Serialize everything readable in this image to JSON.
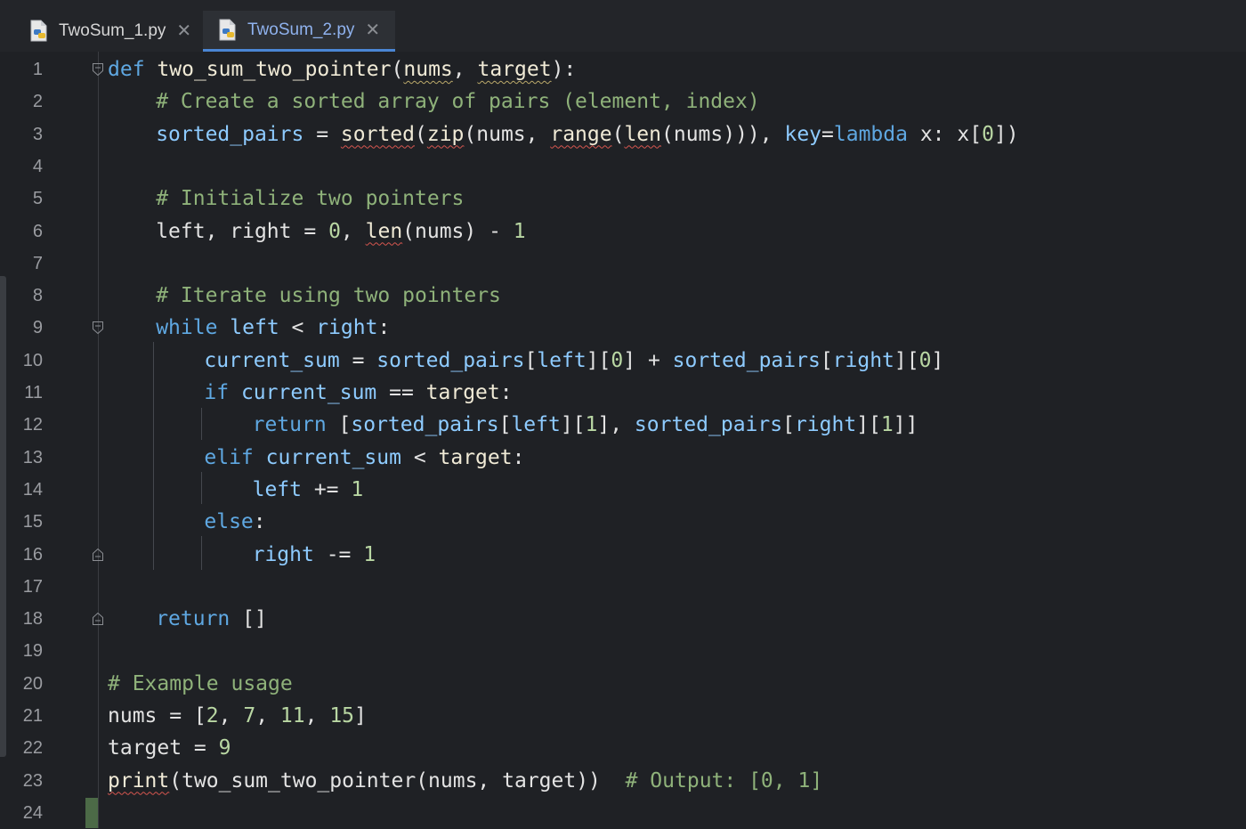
{
  "tabs": [
    {
      "label": "TwoSum_1.py",
      "active": false
    },
    {
      "label": "TwoSum_2.py",
      "active": true
    }
  ],
  "icons": {
    "file": "python-file-icon",
    "close": "close-icon",
    "fold": "fold-marker-icon"
  },
  "colors": {
    "keyword": "#5fa8e2",
    "comment": "#8fb27a",
    "number": "#b9d7a3",
    "variable": "#8ecbff",
    "active_tab": "#8fb2ee",
    "error_squiggle": "#d6564f"
  },
  "line_numbers": [
    "1",
    "2",
    "3",
    "4",
    "5",
    "6",
    "7",
    "8",
    "9",
    "10",
    "11",
    "12",
    "13",
    "14",
    "15",
    "16",
    "17",
    "18",
    "19",
    "20",
    "21",
    "22",
    "23",
    "24"
  ],
  "code_lines": [
    {
      "n": 1,
      "indent": 0,
      "tokens": [
        [
          "kw",
          "def"
        ],
        [
          "pl",
          " "
        ],
        [
          "fn",
          "two_sum_two_pointer"
        ],
        [
          "pl",
          "("
        ],
        [
          "fn wq",
          "nums"
        ],
        [
          "pl",
          ", "
        ],
        [
          "fn wq",
          "target"
        ],
        [
          "pl",
          "):"
        ]
      ]
    },
    {
      "n": 2,
      "indent": 1,
      "tokens": [
        [
          "cm",
          "# Create a sorted array of pairs (element, index)"
        ]
      ]
    },
    {
      "n": 3,
      "indent": 1,
      "tokens": [
        [
          "vr",
          "sorted_pairs"
        ],
        [
          "pl",
          " = "
        ],
        [
          "fn sq",
          "sorted"
        ],
        [
          "pl",
          "("
        ],
        [
          "fn sq",
          "zip"
        ],
        [
          "pl",
          "(nums, "
        ],
        [
          "fn sq",
          "range"
        ],
        [
          "pl",
          "("
        ],
        [
          "fn sq",
          "len"
        ],
        [
          "pl",
          "(nums))), "
        ],
        [
          "vr",
          "key"
        ],
        [
          "pl",
          "="
        ],
        [
          "kw",
          "lambda"
        ],
        [
          "pl",
          " x: x["
        ],
        [
          "nm",
          "0"
        ],
        [
          "pl",
          "])"
        ]
      ]
    },
    {
      "n": 4,
      "indent": 0,
      "tokens": []
    },
    {
      "n": 5,
      "indent": 1,
      "tokens": [
        [
          "cm",
          "# Initialize two pointers"
        ]
      ]
    },
    {
      "n": 6,
      "indent": 1,
      "tokens": [
        [
          "pl",
          "left, right = "
        ],
        [
          "nm",
          "0"
        ],
        [
          "pl",
          ", "
        ],
        [
          "fn sq",
          "len"
        ],
        [
          "pl",
          "(nums) - "
        ],
        [
          "nm",
          "1"
        ]
      ]
    },
    {
      "n": 7,
      "indent": 0,
      "tokens": []
    },
    {
      "n": 8,
      "indent": 1,
      "tokens": [
        [
          "cm",
          "# Iterate using two pointers"
        ]
      ]
    },
    {
      "n": 9,
      "indent": 1,
      "tokens": [
        [
          "kw",
          "while"
        ],
        [
          "pl",
          " "
        ],
        [
          "vr",
          "left"
        ],
        [
          "pl",
          " < "
        ],
        [
          "vr",
          "right"
        ],
        [
          "pl",
          ":"
        ]
      ]
    },
    {
      "n": 10,
      "indent": 2,
      "tokens": [
        [
          "vr",
          "current_sum"
        ],
        [
          "pl",
          " = "
        ],
        [
          "vr",
          "sorted_pairs"
        ],
        [
          "pl",
          "["
        ],
        [
          "vr",
          "left"
        ],
        [
          "pl",
          "]["
        ],
        [
          "nm",
          "0"
        ],
        [
          "pl",
          "] + "
        ],
        [
          "vr",
          "sorted_pairs"
        ],
        [
          "pl",
          "["
        ],
        [
          "vr",
          "right"
        ],
        [
          "pl",
          "]["
        ],
        [
          "nm",
          "0"
        ],
        [
          "pl",
          "]"
        ]
      ]
    },
    {
      "n": 11,
      "indent": 2,
      "tokens": [
        [
          "kw",
          "if"
        ],
        [
          "pl",
          " "
        ],
        [
          "vr",
          "current_sum"
        ],
        [
          "pl",
          " == "
        ],
        [
          "fn",
          "target"
        ],
        [
          "pl",
          ":"
        ]
      ]
    },
    {
      "n": 12,
      "indent": 3,
      "tokens": [
        [
          "kw",
          "return"
        ],
        [
          "pl",
          " ["
        ],
        [
          "vr",
          "sorted_pairs"
        ],
        [
          "pl",
          "["
        ],
        [
          "vr",
          "left"
        ],
        [
          "pl",
          "]["
        ],
        [
          "nm",
          "1"
        ],
        [
          "pl",
          "], "
        ],
        [
          "vr",
          "sorted_pairs"
        ],
        [
          "pl",
          "["
        ],
        [
          "vr",
          "right"
        ],
        [
          "pl",
          "]["
        ],
        [
          "nm",
          "1"
        ],
        [
          "pl",
          "]]"
        ]
      ]
    },
    {
      "n": 13,
      "indent": 2,
      "tokens": [
        [
          "kw",
          "elif"
        ],
        [
          "pl",
          " "
        ],
        [
          "vr",
          "current_sum"
        ],
        [
          "pl",
          " < "
        ],
        [
          "fn",
          "target"
        ],
        [
          "pl",
          ":"
        ]
      ]
    },
    {
      "n": 14,
      "indent": 3,
      "tokens": [
        [
          "vr",
          "left"
        ],
        [
          "pl",
          " += "
        ],
        [
          "nm",
          "1"
        ]
      ]
    },
    {
      "n": 15,
      "indent": 2,
      "tokens": [
        [
          "kw",
          "else"
        ],
        [
          "pl",
          ":"
        ]
      ]
    },
    {
      "n": 16,
      "indent": 3,
      "tokens": [
        [
          "vr",
          "right"
        ],
        [
          "pl",
          " -= "
        ],
        [
          "nm",
          "1"
        ]
      ]
    },
    {
      "n": 17,
      "indent": 0,
      "tokens": []
    },
    {
      "n": 18,
      "indent": 1,
      "tokens": [
        [
          "kw",
          "return"
        ],
        [
          "pl",
          " []"
        ]
      ]
    },
    {
      "n": 19,
      "indent": 0,
      "tokens": []
    },
    {
      "n": 20,
      "indent": 0,
      "tokens": [
        [
          "cm",
          "# Example usage"
        ]
      ]
    },
    {
      "n": 21,
      "indent": 0,
      "tokens": [
        [
          "pl",
          "nums = ["
        ],
        [
          "nm",
          "2"
        ],
        [
          "pl",
          ", "
        ],
        [
          "nm",
          "7"
        ],
        [
          "pl",
          ", "
        ],
        [
          "nm",
          "11"
        ],
        [
          "pl",
          ", "
        ],
        [
          "nm",
          "15"
        ],
        [
          "pl",
          "]"
        ]
      ]
    },
    {
      "n": 22,
      "indent": 0,
      "tokens": [
        [
          "pl",
          "target = "
        ],
        [
          "nm",
          "9"
        ]
      ]
    },
    {
      "n": 23,
      "indent": 0,
      "tokens": [
        [
          "fn sq",
          "print"
        ],
        [
          "pl",
          "(two_sum_two_pointer(nums, target))  "
        ],
        [
          "cm",
          "# Output: [0, 1]"
        ]
      ]
    },
    {
      "n": 24,
      "indent": 0,
      "tokens": []
    }
  ]
}
